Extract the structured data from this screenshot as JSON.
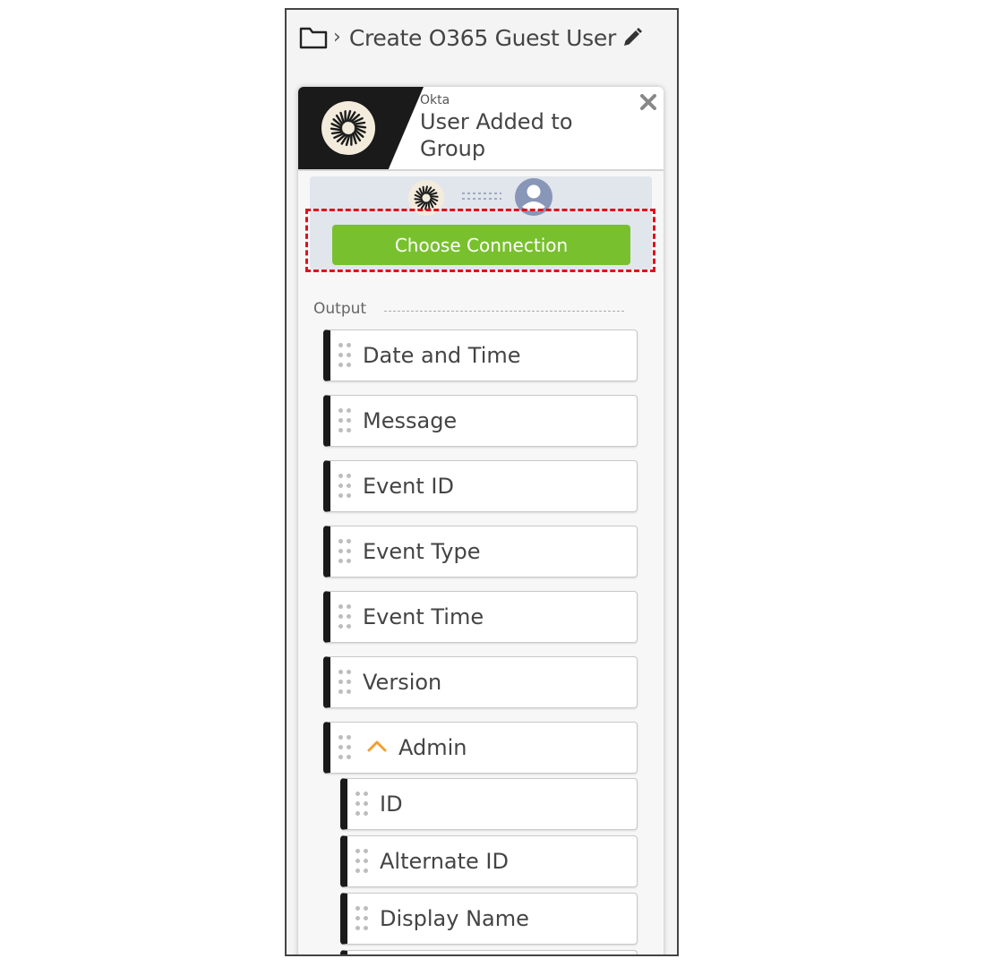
{
  "breadcrumb": {
    "flow_title": "Create O365 Guest User"
  },
  "card": {
    "app_name": "Okta",
    "trigger_name": "User Added to Group",
    "choose_connection_label": "Choose Connection"
  },
  "output": {
    "label": "Output",
    "fields": [
      "Date and Time",
      "Message",
      "Event ID",
      "Event Type",
      "Event Time",
      "Version",
      "Admin"
    ],
    "admin_children": [
      "ID",
      "Alternate ID",
      "Display Name"
    ]
  },
  "colors": {
    "accent_green": "#79c02f",
    "highlight_red": "#e0101e",
    "chevron_orange": "#f0a030"
  }
}
